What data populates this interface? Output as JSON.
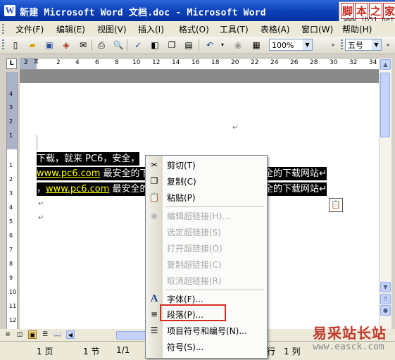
{
  "window": {
    "title": "新建 Microsoft Word 文档.doc - Microsoft Word"
  },
  "watermark_top": {
    "chars": [
      "脚",
      "本",
      "之",
      "家"
    ],
    "url": "www.jb51.net"
  },
  "watermark_bottom": {
    "name": "易采站长站",
    "url": "www.easck.com"
  },
  "menubar": {
    "items": [
      "文件(F)",
      "编辑(E)",
      "视图(V)",
      "插入(I)",
      "格式(O)",
      "工具(T)",
      "表格(A)",
      "窗口(W)",
      "帮助(H)"
    ]
  },
  "toolbar": {
    "zoom": "100%",
    "font_size": "五号"
  },
  "ruler": {
    "numbers": [
      "2",
      "2",
      "4",
      "6",
      "8",
      "10",
      "12",
      "14",
      "16",
      "18",
      "20",
      "22",
      "24",
      "26",
      "28",
      "30",
      "32",
      "34"
    ],
    "vnumbers": [
      "4",
      "3",
      "2",
      "1",
      "1",
      "2",
      "3",
      "4",
      "5",
      "6",
      "7",
      "8",
      "9",
      "10",
      "11",
      "12"
    ]
  },
  "document": {
    "line1": "下载，就来 PC6，安全，",
    "line2_link": "www.pc6.com",
    "line2_text": " 最安全的下",
    "line2_tail": "全的下载网站↵",
    "line3_lead": "，",
    "line3_link": "www.pc6.com",
    "line3_text": " 最安全的",
    "line3_tail": "全的下载网站↵",
    "para_mark": "↵"
  },
  "context_menu": {
    "items": [
      {
        "label": "剪切(T)",
        "icon": "scissors-icon",
        "glyph": "✂",
        "disabled": false
      },
      {
        "label": "复制(C)",
        "icon": "copy-icon",
        "glyph": "❐",
        "disabled": false
      },
      {
        "label": "粘贴(P)",
        "icon": "paste-icon",
        "glyph": "📋",
        "disabled": false
      },
      {
        "label": "编辑超链接(H)...",
        "icon": "hyperlink-icon",
        "glyph": "◉",
        "disabled": true
      },
      {
        "label": "选定超链接(S)",
        "icon": "",
        "glyph": "",
        "disabled": true
      },
      {
        "label": "打开超链接(O)",
        "icon": "",
        "glyph": "",
        "disabled": true
      },
      {
        "label": "复制超链接(C)",
        "icon": "",
        "glyph": "",
        "disabled": true
      },
      {
        "label": "取消超链接(R)",
        "icon": "",
        "glyph": "",
        "disabled": true
      },
      {
        "label": "字体(F)...",
        "icon": "font-icon",
        "glyph": "A",
        "disabled": false
      },
      {
        "label": "段落(P)...",
        "icon": "paragraph-icon",
        "glyph": "≡",
        "disabled": false
      },
      {
        "label": "项目符号和编号(N)...",
        "icon": "bullets-icon",
        "glyph": "☰",
        "disabled": false
      },
      {
        "label": "符号(S)...",
        "icon": "",
        "glyph": "",
        "disabled": false
      }
    ]
  },
  "statusbar": {
    "page": "1 页",
    "section": "1 节",
    "pages": "1/1",
    "line": "行",
    "col": "1 列"
  },
  "colors": {
    "highlight_box": "#d62b1e",
    "link": "#ffff00",
    "title_bar": "#0a3fb8"
  }
}
